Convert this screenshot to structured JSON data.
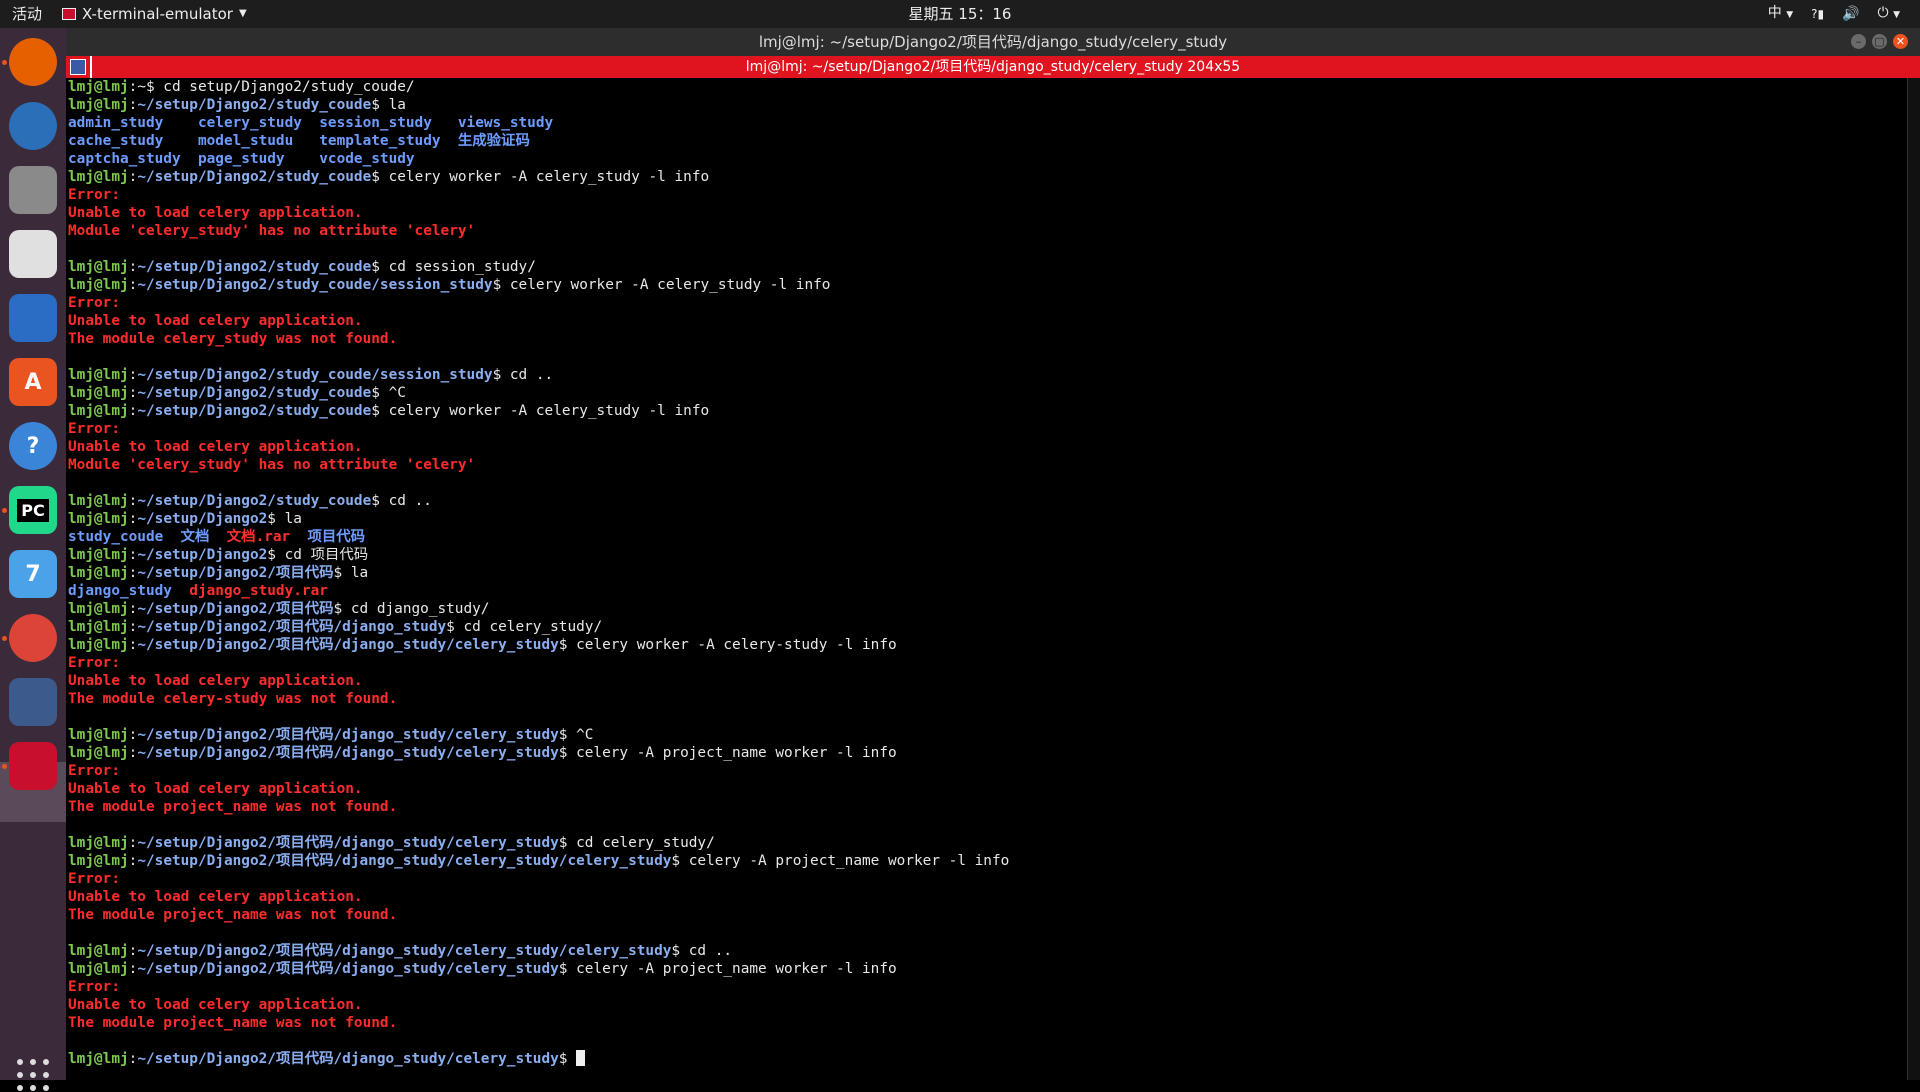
{
  "topbar": {
    "activities": "活动",
    "app_name": "X-terminal-emulator",
    "clock": "星期五 15：16",
    "input_method": "中",
    "tray_question": "?"
  },
  "window": {
    "title": "lmj@lmj: ~/setup/Django2/项目代码/django_study/celery_study",
    "xterm_title": "lmj@lmj: ~/setup/Django2/项目代码/django_study/celery_study 204x55"
  },
  "terminal": {
    "lines": [
      [
        [
          "prompt",
          "lmj@lmj"
        ],
        [
          "cmd",
          ":~$ cd setup/Django2/study_coude/"
        ]
      ],
      [
        [
          "prompt",
          "lmj@lmj"
        ],
        [
          "cmd",
          ":"
        ],
        [
          "path",
          "~/setup/Django2/study_coude"
        ],
        [
          "cmd",
          "$ la"
        ]
      ],
      [
        [
          "dir",
          "admin_study    celery_study  session_study   views_study"
        ]
      ],
      [
        [
          "dir",
          "cache_study    model_studu   template_study  生成验证码"
        ]
      ],
      [
        [
          "dir",
          "captcha_study  page_study    vcode_study"
        ]
      ],
      [
        [
          "prompt",
          "lmj@lmj"
        ],
        [
          "cmd",
          ":"
        ],
        [
          "path",
          "~/setup/Django2/study_coude"
        ],
        [
          "cmd",
          "$ celery worker -A celery_study -l info"
        ]
      ],
      [
        [
          "err",
          "Error:"
        ]
      ],
      [
        [
          "err",
          "Unable to load celery application."
        ]
      ],
      [
        [
          "err",
          "Module 'celery_study' has no attribute 'celery'"
        ]
      ],
      [],
      [
        [
          "prompt",
          "lmj@lmj"
        ],
        [
          "cmd",
          ":"
        ],
        [
          "path",
          "~/setup/Django2/study_coude"
        ],
        [
          "cmd",
          "$ cd session_study/"
        ]
      ],
      [
        [
          "prompt",
          "lmj@lmj"
        ],
        [
          "cmd",
          ":"
        ],
        [
          "path",
          "~/setup/Django2/study_coude/session_study"
        ],
        [
          "cmd",
          "$ celery worker -A celery_study -l info"
        ]
      ],
      [
        [
          "err",
          "Error:"
        ]
      ],
      [
        [
          "err",
          "Unable to load celery application."
        ]
      ],
      [
        [
          "err",
          "The module celery_study was not found."
        ]
      ],
      [],
      [
        [
          "prompt",
          "lmj@lmj"
        ],
        [
          "cmd",
          ":"
        ],
        [
          "path",
          "~/setup/Django2/study_coude/session_study"
        ],
        [
          "cmd",
          "$ cd .."
        ]
      ],
      [
        [
          "prompt",
          "lmj@lmj"
        ],
        [
          "cmd",
          ":"
        ],
        [
          "path",
          "~/setup/Django2/study_coude"
        ],
        [
          "cmd",
          "$ ^C"
        ]
      ],
      [
        [
          "prompt",
          "lmj@lmj"
        ],
        [
          "cmd",
          ":"
        ],
        [
          "path",
          "~/setup/Django2/study_coude"
        ],
        [
          "cmd",
          "$ celery worker -A celery_study -l info"
        ]
      ],
      [
        [
          "err",
          "Error:"
        ]
      ],
      [
        [
          "err",
          "Unable to load celery application."
        ]
      ],
      [
        [
          "err",
          "Module 'celery_study' has no attribute 'celery'"
        ]
      ],
      [],
      [
        [
          "prompt",
          "lmj@lmj"
        ],
        [
          "cmd",
          ":"
        ],
        [
          "path",
          "~/setup/Django2/study_coude"
        ],
        [
          "cmd",
          "$ cd .."
        ]
      ],
      [
        [
          "prompt",
          "lmj@lmj"
        ],
        [
          "cmd",
          ":"
        ],
        [
          "path",
          "~/setup/Django2"
        ],
        [
          "cmd",
          "$ la"
        ]
      ],
      [
        [
          "dir",
          "study_coude  文档  "
        ],
        [
          "rar",
          "文档.rar"
        ],
        [
          "dir",
          "  项目代码"
        ]
      ],
      [
        [
          "prompt",
          "lmj@lmj"
        ],
        [
          "cmd",
          ":"
        ],
        [
          "path",
          "~/setup/Django2"
        ],
        [
          "cmd",
          "$ cd 项目代码"
        ]
      ],
      [
        [
          "prompt",
          "lmj@lmj"
        ],
        [
          "cmd",
          ":"
        ],
        [
          "path",
          "~/setup/Django2/项目代码"
        ],
        [
          "cmd",
          "$ la"
        ]
      ],
      [
        [
          "dir",
          "django_study  "
        ],
        [
          "rar",
          "django_study.rar"
        ]
      ],
      [
        [
          "prompt",
          "lmj@lmj"
        ],
        [
          "cmd",
          ":"
        ],
        [
          "path",
          "~/setup/Django2/项目代码"
        ],
        [
          "cmd",
          "$ cd django_study/"
        ]
      ],
      [
        [
          "prompt",
          "lmj@lmj"
        ],
        [
          "cmd",
          ":"
        ],
        [
          "path",
          "~/setup/Django2/项目代码/django_study"
        ],
        [
          "cmd",
          "$ cd celery_study/"
        ]
      ],
      [
        [
          "prompt",
          "lmj@lmj"
        ],
        [
          "cmd",
          ":"
        ],
        [
          "path",
          "~/setup/Django2/项目代码/django_study/celery_study"
        ],
        [
          "cmd",
          "$ celery worker -A celery-study -l info"
        ]
      ],
      [
        [
          "err",
          "Error:"
        ]
      ],
      [
        [
          "err",
          "Unable to load celery application."
        ]
      ],
      [
        [
          "err",
          "The module celery-study was not found."
        ]
      ],
      [],
      [
        [
          "prompt",
          "lmj@lmj"
        ],
        [
          "cmd",
          ":"
        ],
        [
          "path",
          "~/setup/Django2/项目代码/django_study/celery_study"
        ],
        [
          "cmd",
          "$ ^C"
        ]
      ],
      [
        [
          "prompt",
          "lmj@lmj"
        ],
        [
          "cmd",
          ":"
        ],
        [
          "path",
          "~/setup/Django2/项目代码/django_study/celery_study"
        ],
        [
          "cmd",
          "$ celery -A project_name worker -l info"
        ]
      ],
      [
        [
          "err",
          "Error:"
        ]
      ],
      [
        [
          "err",
          "Unable to load celery application."
        ]
      ],
      [
        [
          "err",
          "The module project_name was not found."
        ]
      ],
      [],
      [
        [
          "prompt",
          "lmj@lmj"
        ],
        [
          "cmd",
          ":"
        ],
        [
          "path",
          "~/setup/Django2/项目代码/django_study/celery_study"
        ],
        [
          "cmd",
          "$ cd celery_study/"
        ]
      ],
      [
        [
          "prompt",
          "lmj@lmj"
        ],
        [
          "cmd",
          ":"
        ],
        [
          "path",
          "~/setup/Django2/项目代码/django_study/celery_study/celery_study"
        ],
        [
          "cmd",
          "$ celery -A project_name worker -l info"
        ]
      ],
      [
        [
          "err",
          "Error:"
        ]
      ],
      [
        [
          "err",
          "Unable to load celery application."
        ]
      ],
      [
        [
          "err",
          "The module project_name was not found."
        ]
      ],
      [],
      [
        [
          "prompt",
          "lmj@lmj"
        ],
        [
          "cmd",
          ":"
        ],
        [
          "path",
          "~/setup/Django2/项目代码/django_study/celery_study/celery_study"
        ],
        [
          "cmd",
          "$ cd .."
        ]
      ],
      [
        [
          "prompt",
          "lmj@lmj"
        ],
        [
          "cmd",
          ":"
        ],
        [
          "path",
          "~/setup/Django2/项目代码/django_study/celery_study"
        ],
        [
          "cmd",
          "$ celery -A project_name worker -l info"
        ]
      ],
      [
        [
          "err",
          "Error:"
        ]
      ],
      [
        [
          "err",
          "Unable to load celery application."
        ]
      ],
      [
        [
          "err",
          "The module project_name was not found."
        ]
      ],
      [],
      [
        [
          "prompt",
          "lmj@lmj"
        ],
        [
          "cmd",
          ":"
        ],
        [
          "path",
          "~/setup/Django2/项目代码/django_study/celery_study"
        ],
        [
          "cmd",
          "$ "
        ]
      ]
    ]
  },
  "dock": {
    "items": [
      {
        "icon": "firefox-icon",
        "color": "#e66000",
        "glyph": ""
      },
      {
        "icon": "thunderbird-icon",
        "color": "#2a6fb8",
        "glyph": ""
      },
      {
        "icon": "files-icon",
        "color": "#8a8a8a",
        "glyph": ""
      },
      {
        "icon": "rhythmbox-icon",
        "color": "#e0e0e0",
        "glyph": ""
      },
      {
        "icon": "libreoffice-writer-icon",
        "color": "#2b6cc4",
        "glyph": ""
      },
      {
        "icon": "software-center-icon",
        "color": "#e95420",
        "glyph": "A"
      },
      {
        "icon": "help-icon",
        "color": "#3a85d8",
        "glyph": "?"
      },
      {
        "icon": "pycharm-icon",
        "color": "#21d789",
        "glyph": "PC"
      },
      {
        "icon": "visual-studio-icon",
        "color": "#4aa3e8",
        "glyph": "7"
      },
      {
        "icon": "chrome-icon",
        "color": "#db4437",
        "glyph": ""
      },
      {
        "icon": "virtualbox-icon",
        "color": "#3d5a8c",
        "glyph": ""
      },
      {
        "icon": "terminal-icon",
        "color": "#c8102e",
        "glyph": ""
      }
    ]
  }
}
